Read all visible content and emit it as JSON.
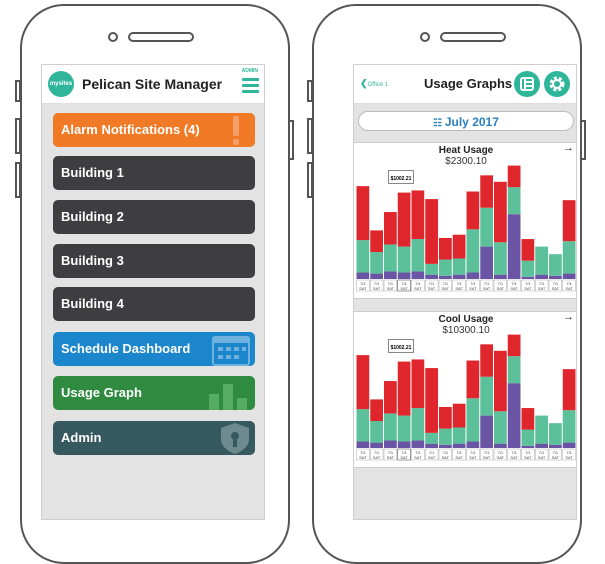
{
  "left_app": {
    "logo_text": "mysites",
    "title": "Pelican Site Manager",
    "admin_label": "ADMIN",
    "menu": [
      {
        "label": "Alarm Notifications (4)",
        "color": "#f07a26",
        "icon": "exclamation-icon"
      },
      {
        "label": "Building 1",
        "color": "#3e3e40",
        "icon": ""
      },
      {
        "label": "Building 2",
        "color": "#3e3e40",
        "icon": ""
      },
      {
        "label": "Building 3",
        "color": "#3e3e40",
        "icon": ""
      },
      {
        "label": "Building 4",
        "color": "#3e3e40",
        "icon": ""
      },
      {
        "label": "Schedule Dashboard",
        "color": "#1b86cc",
        "icon": "calendar-icon"
      },
      {
        "label": "Usage Graph",
        "color": "#2f8b40",
        "icon": "bar-chart-icon"
      },
      {
        "label": "Admin",
        "color": "#36595f",
        "icon": "shield-lock-icon"
      }
    ]
  },
  "right_app": {
    "back_label": "Office 1",
    "title": "Usage Graphs",
    "month": "July 2017",
    "calendar_icon": "calendar-icon",
    "arrow": "→",
    "tooltip_value": "$1002.21",
    "tick_top": "7/1",
    "tick_bottom": "SAT"
  },
  "chart_data": [
    {
      "type": "bar",
      "title": "Heat Usage",
      "subtitle": "$2300.10",
      "categories": [
        "7/1",
        "7/1",
        "7/1",
        "7/1",
        "7/1",
        "7/1",
        "7/1",
        "7/1",
        "7/1",
        "7/1",
        "7/1",
        "7/1",
        "7/1",
        "7/1",
        "7/1",
        "7/1"
      ],
      "series": [
        {
          "color": "#6a55a5",
          "values": [
            6,
            5,
            7,
            6,
            7,
            4,
            3,
            4,
            6,
            30,
            4,
            60,
            2,
            4,
            3,
            5
          ]
        },
        {
          "color": "#5cc09a",
          "values": [
            30,
            20,
            25,
            24,
            30,
            10,
            15,
            15,
            40,
            36,
            30,
            25,
            15,
            26,
            20,
            30
          ]
        },
        {
          "color": "#e0262d",
          "values": [
            50,
            20,
            30,
            50,
            45,
            60,
            20,
            22,
            35,
            30,
            56,
            20,
            20,
            0,
            0,
            38
          ]
        }
      ]
    },
    {
      "type": "bar",
      "title": "Cool Usage",
      "subtitle": "$10300.10",
      "categories": [
        "7/1",
        "7/1",
        "7/1",
        "7/1",
        "7/1",
        "7/1",
        "7/1",
        "7/1",
        "7/1",
        "7/1",
        "7/1",
        "7/1",
        "7/1",
        "7/1",
        "7/1",
        "7/1"
      ],
      "series": [
        {
          "color": "#6a55a5",
          "values": [
            6,
            5,
            7,
            6,
            7,
            4,
            3,
            4,
            6,
            30,
            4,
            60,
            2,
            4,
            3,
            5
          ]
        },
        {
          "color": "#5cc09a",
          "values": [
            30,
            20,
            25,
            24,
            30,
            10,
            15,
            15,
            40,
            36,
            30,
            25,
            15,
            26,
            20,
            30
          ]
        },
        {
          "color": "#e0262d",
          "values": [
            50,
            20,
            30,
            50,
            45,
            60,
            20,
            22,
            35,
            30,
            56,
            20,
            20,
            0,
            0,
            38
          ]
        }
      ]
    }
  ]
}
